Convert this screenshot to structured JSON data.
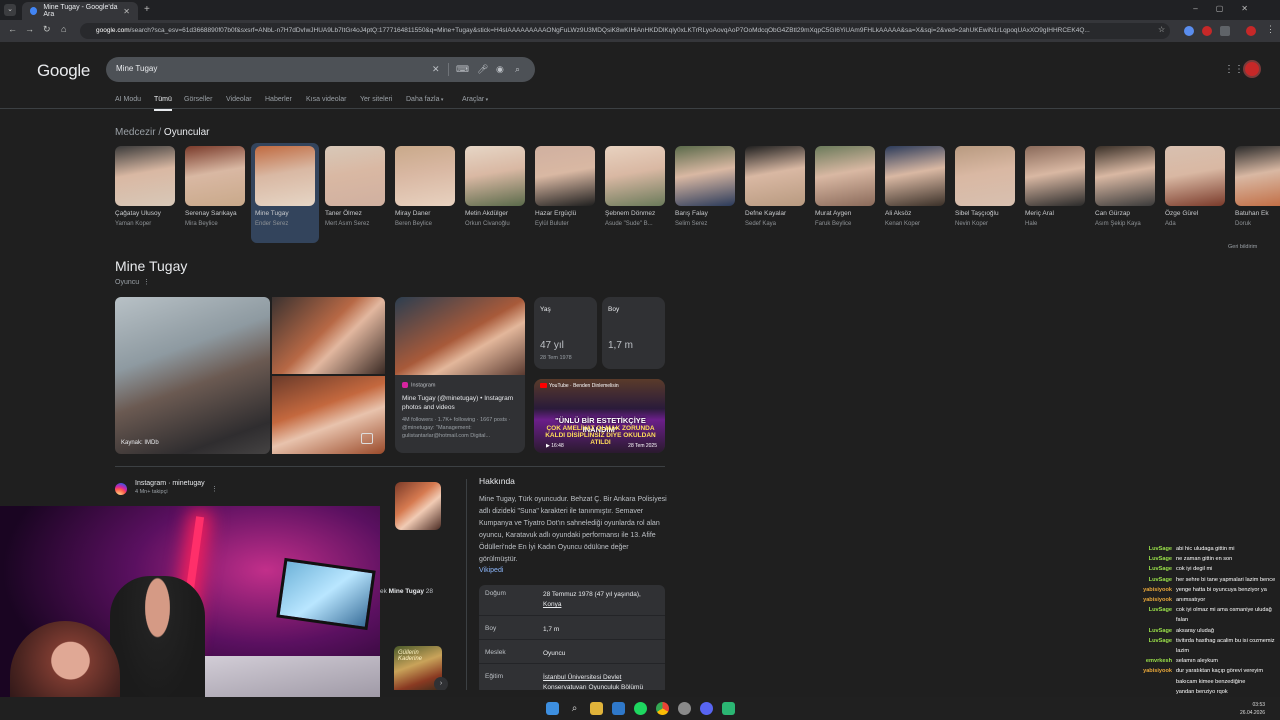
{
  "browser": {
    "tab_title": "Mine Tugay - Google'da Ara",
    "url_host": "google.com",
    "url_rest": "/search?sca_esv=61d3668890f07b0f&sxsrf=ANbL-n7H7dDvIwJHUA9Lb7ItGr4oJ4ptQ:1777164811550&q=Mine+Tugay&stick=H4sIAAAAAAAAAONgFuLWz9U3MDQsiK8wKIHiAnHKDDlKqly0xLKTrRLyoAovqAoP7OoMdcqObG4ZBtl29mXqpC5GI6YiUAm9FHLkAAAAA&sa=X&sqi=2&ved=2ahUKEwiN1rLqpoqUAxXO9gIHHRCEK4Q..."
  },
  "google": {
    "logo": "Google",
    "query": "Mine Tugay",
    "nav_tabs": [
      "AI Modu",
      "Tümü",
      "Görseller",
      "Videolar",
      "Haberler",
      "Kısa videolar",
      "Yer siteleri",
      "Daha fazla",
      "Araçlar"
    ],
    "breadcrumb_prefix": "Medcezir",
    "breadcrumb_sep": " / ",
    "breadcrumb_current": "Oyuncular",
    "actors": [
      {
        "name": "Çağatay Ulusoy",
        "character": "Yaman Koper"
      },
      {
        "name": "Serenay Sarıkaya",
        "character": "Mira Beylice"
      },
      {
        "name": "Mine Tugay",
        "character": "Ender Serez"
      },
      {
        "name": "Taner Ölmez",
        "character": "Mert Asım Serez"
      },
      {
        "name": "Miray Daner",
        "character": "Beren Beylice"
      },
      {
        "name": "Metin Akdülger",
        "character": "Orkun Civanoğlu"
      },
      {
        "name": "Hazar Ergüçlü",
        "character": "Eylül Buluter"
      },
      {
        "name": "Şebnem Dönmez",
        "character": "Asude \"Sude\" B..."
      },
      {
        "name": "Barış Falay",
        "character": "Selim Serez"
      },
      {
        "name": "Defne Kayalar",
        "character": "Sedef Kaya"
      },
      {
        "name": "Murat Aygen",
        "character": "Faruk Beylice"
      },
      {
        "name": "Ali Aksöz",
        "character": "Kenan Koper"
      },
      {
        "name": "Sibel Taşçıoğlu",
        "character": "Nevin Koper"
      },
      {
        "name": "Meriç Aral",
        "character": "Hale"
      },
      {
        "name": "Can Gürzap",
        "character": "Asım Şekip Kaya"
      },
      {
        "name": "Özge Gürel",
        "character": "Ada"
      },
      {
        "name": "Batuhan Ek",
        "character": "Doruk"
      }
    ],
    "feedback": "Geri bildirim",
    "entity": {
      "title": "Mine Tugay",
      "subtitle": "Oyuncu",
      "image_caption": "Kaynak: IMDb",
      "instagram_card": {
        "source": "Instagram",
        "title": "Mine Tugay (@minetugay) • Instagram photos and videos",
        "meta": "4M followers · 1.7K+ following · 1667 posts · @minetugay: \"Management: gulistantarlar@hotmail.com Digital..."
      },
      "age": {
        "label": "Yaş",
        "value": "47 yıl",
        "sub": "28 Tem 1978"
      },
      "height": {
        "label": "Boy",
        "value": "1,7 m"
      },
      "youtube_card": {
        "source": "YouTube · Benden Dinlemelisin",
        "headline1": "\"ÜNLÜ BİR ESTETİKÇİYE İNANDIM\"",
        "headline2": "ÇOK AMELİYAT OLMAK ZORUNDA KALDI DİSİPLİNSİZ DİYE OKULDAN ATILDI",
        "duration": "16:48",
        "date": "28 Tem 2025"
      }
    },
    "instagram_result": {
      "name": "Instagram · minetugay",
      "followers": "4 Mn+ takipçi",
      "dots": "⋮"
    },
    "mid_text_prefix": "ek ",
    "mid_text_bold": "Mine Tugay",
    "mid_text_suffix": " 28",
    "book_text": "Güllerin Kaderine",
    "about": {
      "heading": "Hakkında",
      "text": "Mine Tugay, Türk oyuncudur. Behzat Ç. Bir Ankara Polisiyesi adlı dizideki \"Suna\" karakteri ile tanınmıştır. Semaver Kumpanya ve Tiyatro Dot'ın sahnelediği oyunlarda rol alan oyuncu, Karatavuk adlı oyundaki performansı ile 13. Afife Ödülleri'nde En İyi Kadın Oyuncu ödülüne değer görülmüştür.",
      "link": "Vikipedi"
    },
    "facts": [
      {
        "key": "Doğum",
        "value": "28 Temmuz 1978 (47 yıl yaşında),",
        "link": "Konya"
      },
      {
        "key": "Boy",
        "value": "1,7 m",
        "link": ""
      },
      {
        "key": "Meslek",
        "value": "Oyuncu",
        "link": ""
      },
      {
        "key": "Eğitim",
        "value": "",
        "link": "İstanbul Üniversitesi Devlet Konservatuvarı Oyunculuk Bölümü"
      }
    ]
  },
  "chat": [
    {
      "user": "LuvSage",
      "color": "#9ae04a",
      "text": "abi hic uludaga gittin mi"
    },
    {
      "user": "LuvSage",
      "color": "#9ae04a",
      "text": "ne zaman gittin en son"
    },
    {
      "user": "LuvSage",
      "color": "#9ae04a",
      "text": "cok iyi degil mi"
    },
    {
      "user": "LuvSage",
      "color": "#9ae04a",
      "text": "her sehre bi tane yapmalari lazim bence"
    },
    {
      "user": "yabisiyook",
      "color": "#e9a83a",
      "text": "yenge hatta bi oyuncuya benziyor ya"
    },
    {
      "user": "yabisiyook",
      "color": "#e9a83a",
      "text": "anımsatıyor"
    },
    {
      "user": "LuvSage",
      "color": "#9ae04a",
      "text": "cok iyi olmaz mi ama osmaniye uludağ falan"
    },
    {
      "user": "LuvSage",
      "color": "#9ae04a",
      "text": "aksaray uludağ"
    },
    {
      "user": "LuvSage",
      "color": "#9ae04a",
      "text": "tivitırda hasthag acalim bu isi cozmemiz lazim"
    },
    {
      "user": "emvrkesh",
      "color": "#9ae04a",
      "text": "selamın aleykum"
    },
    {
      "user": "yabisiyook",
      "color": "#e9a83a",
      "text": "dur yaratıktan kaçıp görevi vereyim bakıcam kimee benzediğine"
    },
    {
      "user": "",
      "color": "#ffffff",
      "text": "yandan benziyo rqok"
    }
  ],
  "taskbar": {
    "time": "03:53",
    "date": "26.04.2026"
  }
}
